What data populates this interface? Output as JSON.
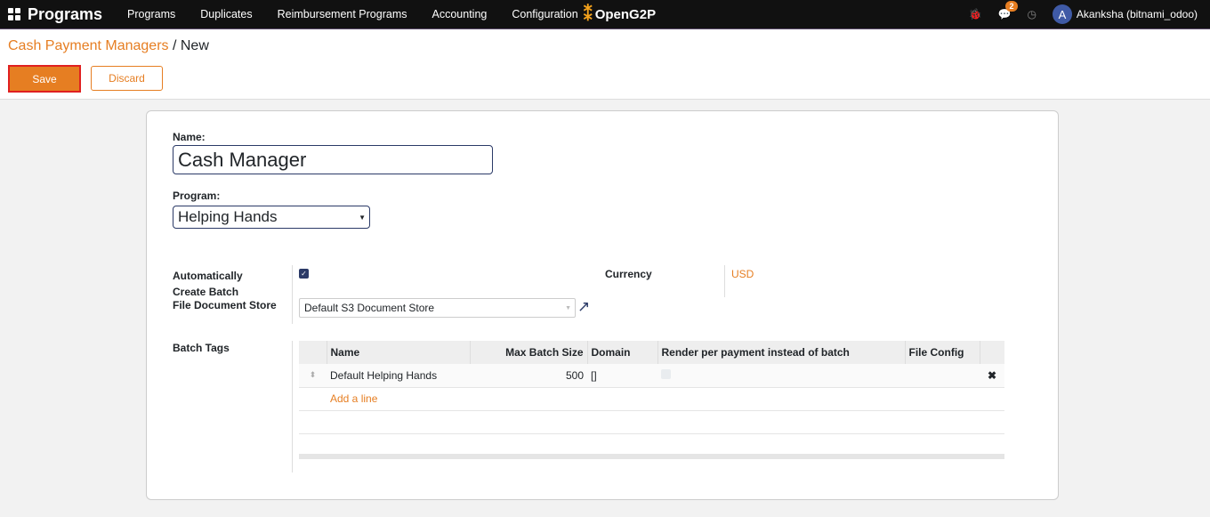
{
  "nav": {
    "brand": "Programs",
    "menu": [
      "Programs",
      "Duplicates",
      "Reimbursement Programs",
      "Accounting",
      "Configuration"
    ],
    "logo": "OpenG2P",
    "messages_count": "2",
    "user_initial": "A",
    "user": "Akanksha (bitnami_odoo)"
  },
  "breadcrumb": {
    "parent": "Cash Payment Managers",
    "sep": " / ",
    "current": "New"
  },
  "buttons": {
    "save": "Save",
    "discard": "Discard"
  },
  "form": {
    "name_label": "Name:",
    "name_value": "Cash Manager",
    "program_label": "Program:",
    "program_value": "Helping Hands",
    "auto_batch_label": "Automatically Create Batch",
    "auto_batch_checked": true,
    "currency_label": "Currency",
    "currency_value": "USD",
    "file_store_label": "File Document Store",
    "file_store_value": "Default S3 Document Store",
    "batch_tags_label": "Batch Tags"
  },
  "table": {
    "headers": [
      "Name",
      "Max Batch Size",
      "Domain",
      "Render per payment instead of batch",
      "File Config"
    ],
    "rows": [
      {
        "name": "Default Helping Hands",
        "max": "500",
        "domain": "[]",
        "render": false,
        "file_config": ""
      }
    ],
    "add_line": "Add a line"
  }
}
